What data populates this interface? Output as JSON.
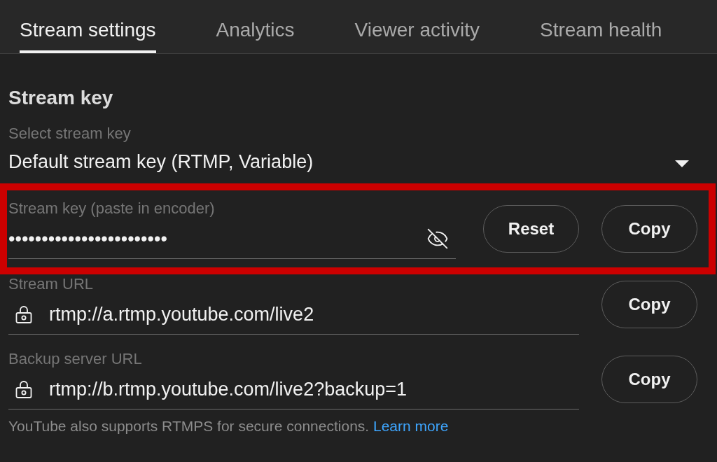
{
  "tabs": [
    {
      "label": "Stream settings",
      "selected": true
    },
    {
      "label": "Analytics",
      "selected": false
    },
    {
      "label": "Viewer activity",
      "selected": false
    },
    {
      "label": "Stream health",
      "selected": false
    }
  ],
  "stream_key": {
    "title": "Stream key",
    "select": {
      "label": "Select stream key",
      "value": "Default stream key (RTMP, Variable)"
    },
    "fields": [
      {
        "kind": "secret",
        "label": "Stream key (paste in encoder)",
        "value": "••••••••••••••••••••••••",
        "highlighted": true,
        "buttons": [
          "Reset",
          "Copy"
        ]
      },
      {
        "kind": "locked",
        "label": "Stream URL",
        "value": "rtmp://a.rtmp.youtube.com/live2",
        "highlighted": false,
        "buttons": [
          "Copy"
        ]
      },
      {
        "kind": "locked",
        "label": "Backup server URL",
        "value": "rtmp://b.rtmp.youtube.com/live2?backup=1",
        "highlighted": false,
        "buttons": [
          "Copy"
        ]
      }
    ],
    "note": {
      "text": "YouTube also supports RTMPS for secure connections.",
      "link": "Learn more"
    }
  }
}
